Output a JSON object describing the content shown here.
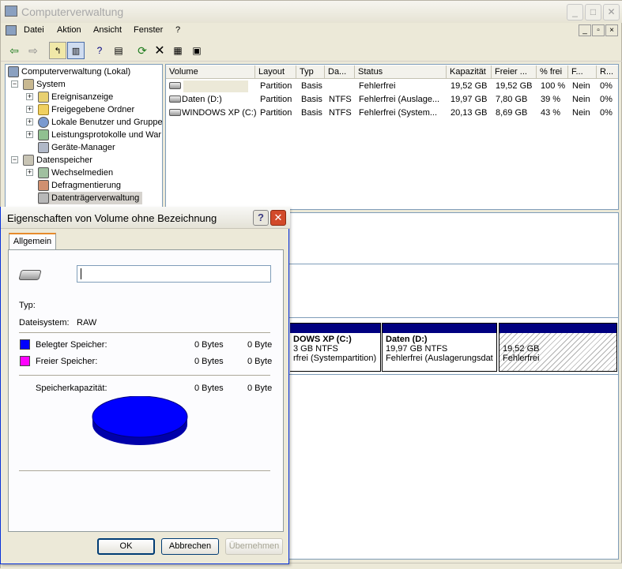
{
  "window": {
    "title": "Computerverwaltung"
  },
  "menu": [
    "Datei",
    "Aktion",
    "Ansicht",
    "Fenster",
    "?"
  ],
  "tree": {
    "root": "Computerverwaltung (Lokal)",
    "system": "System",
    "ereignis": "Ereignisanzeige",
    "freigabe": "Freigegebene Ordner",
    "benutzer": "Lokale Benutzer und Gruppe",
    "leistung": "Leistungsprotokolle und War",
    "geraete": "Geräte-Manager",
    "datenspeicher": "Datenspeicher",
    "wechsel": "Wechselmedien",
    "defrag": "Defragmentierung",
    "dtv": "Datenträgerverwaltung"
  },
  "list": {
    "columns": [
      "Volume",
      "Layout",
      "Typ",
      "Da...",
      "Status",
      "Kapazität",
      "Freier ...",
      "% frei",
      "F...",
      "R..."
    ],
    "rows": [
      [
        "",
        "Partition",
        "Basis",
        "",
        "Fehlerfrei",
        "19,52 GB",
        "19,52 GB",
        "100 %",
        "Nein",
        "0%"
      ],
      [
        "Daten (D:)",
        "Partition",
        "Basis",
        "NTFS",
        "Fehlerfrei (Auslage...",
        "19,97 GB",
        "7,80 GB",
        "39 %",
        "Nein",
        "0%"
      ],
      [
        "WINDOWS XP (C:)",
        "Partition",
        "Basis",
        "NTFS",
        "Fehlerfrei (System...",
        "20,13 GB",
        "8,69 GB",
        "43 %",
        "Nein",
        "0%"
      ]
    ]
  },
  "diskmap": {
    "c": {
      "title": "DOWS XP  (C:)",
      "size": "3 GB NTFS",
      "status": "rfrei (Systempartition)"
    },
    "d": {
      "title": "Daten  (D:)",
      "size": "19,97 GB NTFS",
      "status": "Fehlerfrei (Auslagerungsdat"
    },
    "u": {
      "size": "19,52 GB",
      "status": "Fehlerfrei"
    }
  },
  "dialog": {
    "title": "Eigenschaften von Volume ohne Bezeichnung",
    "tab": "Allgemein",
    "volume_name": "",
    "typ_label": "Typ:",
    "fs_label": "Dateisystem:",
    "fs_value": "RAW",
    "used_label": "Belegter Speicher:",
    "used_bytes": "0 Bytes",
    "used_size": "0 Byte",
    "free_label": "Freier Speicher:",
    "free_bytes": "0 Bytes",
    "free_size": "0 Byte",
    "cap_label": "Speicherkapazität:",
    "cap_bytes": "0 Bytes",
    "cap_size": "0 Byte",
    "ok": "OK",
    "cancel": "Abbrechen",
    "apply": "Übernehmen",
    "colors": {
      "used": "#0000ff",
      "free": "#ff00ff"
    }
  }
}
